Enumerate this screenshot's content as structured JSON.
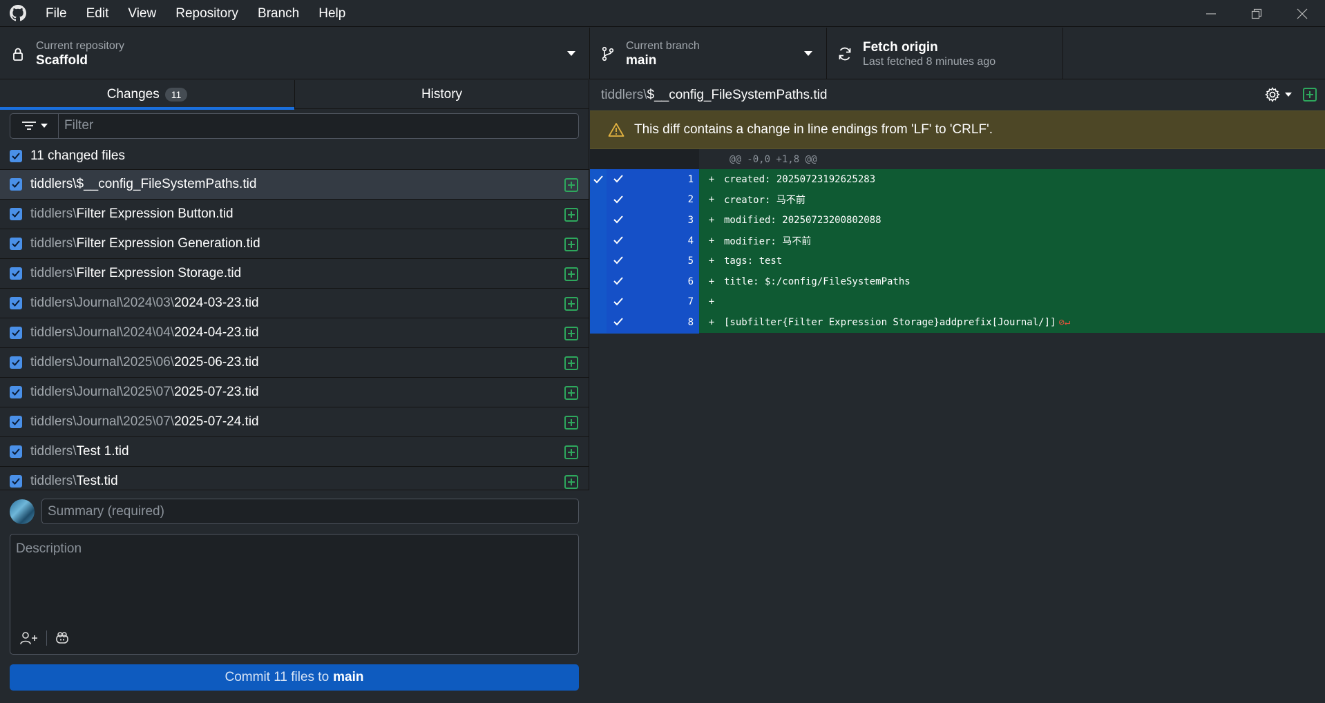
{
  "menu": [
    "File",
    "Edit",
    "View",
    "Repository",
    "Branch",
    "Help"
  ],
  "toolbar": {
    "repo_label": "Current repository",
    "repo_value": "Scaffold",
    "branch_label": "Current branch",
    "branch_value": "main",
    "fetch_label": "Fetch origin",
    "fetch_sub": "Last fetched 8 minutes ago"
  },
  "tabs": {
    "changes": "Changes",
    "changes_count": "11",
    "history": "History"
  },
  "filter": {
    "placeholder": "Filter"
  },
  "changed_files_label": "11 changed files",
  "files": [
    {
      "dir": "tiddlers\\",
      "base": "$__config_FileSystemPaths.tid"
    },
    {
      "dir": "tiddlers\\",
      "base": "Filter Expression Button.tid"
    },
    {
      "dir": "tiddlers\\",
      "base": "Filter Expression Generation.tid"
    },
    {
      "dir": "tiddlers\\",
      "base": "Filter Expression Storage.tid"
    },
    {
      "dir": "tiddlers\\Journal\\2024\\03\\",
      "base": "2024-03-23.tid"
    },
    {
      "dir": "tiddlers\\Journal\\2024\\04\\",
      "base": "2024-04-23.tid"
    },
    {
      "dir": "tiddlers\\Journal\\2025\\06\\",
      "base": "2025-06-23.tid"
    },
    {
      "dir": "tiddlers\\Journal\\2025\\07\\",
      "base": "2025-07-23.tid"
    },
    {
      "dir": "tiddlers\\Journal\\2025\\07\\",
      "base": "2025-07-24.tid"
    },
    {
      "dir": "tiddlers\\",
      "base": "Test 1.tid"
    },
    {
      "dir": "tiddlers\\",
      "base": "Test.tid"
    }
  ],
  "commit": {
    "summary_placeholder": "Summary (required)",
    "description_placeholder": "Description",
    "button_prefix": "Commit 11 files to",
    "button_branch": "main"
  },
  "diff": {
    "path_dir": "tiddlers\\",
    "path_base": "$__config_FileSystemPaths.tid",
    "warning": "This diff contains a change in line endings from 'LF' to 'CRLF'.",
    "hunk": "@@ -0,0 +1,8 @@",
    "lines": [
      {
        "num": "1",
        "sign": "+",
        "text": "created: 20250723192625283"
      },
      {
        "num": "2",
        "sign": "+",
        "text": "creator: 马不前"
      },
      {
        "num": "3",
        "sign": "+",
        "text": "modified: 20250723200802088"
      },
      {
        "num": "4",
        "sign": "+",
        "text": "modifier: 马不前"
      },
      {
        "num": "5",
        "sign": "+",
        "text": "tags: test"
      },
      {
        "num": "6",
        "sign": "+",
        "text": "title: $:/config/FileSystemPaths"
      },
      {
        "num": "7",
        "sign": "+",
        "text": ""
      },
      {
        "num": "8",
        "sign": "+",
        "text": "[subfilter{Filter Expression Storage}addprefix[Journal/]]"
      }
    ]
  },
  "colors": {
    "accent": "#1a6fdd",
    "added_bg": "#0f5a33",
    "gutter_selected": "#1550c7",
    "warning_bg": "#4d4726",
    "add_icon": "#2ea85d"
  }
}
